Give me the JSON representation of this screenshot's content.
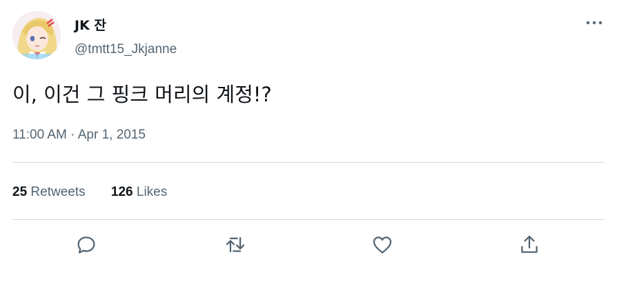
{
  "author": {
    "display_name": "JK 잔",
    "handle": "@tmtt15_Jkjanne",
    "avatar": "anime-girl-avatar"
  },
  "tweet": {
    "text": "이, 이건 그 핑크 머리의 계정!?",
    "time": "11:00 AM",
    "separator": "·",
    "date": "Apr 1, 2015"
  },
  "stats": {
    "retweets_count": "25",
    "retweets_label": "Retweets",
    "likes_count": "126",
    "likes_label": "Likes"
  },
  "actions": {
    "reply": "reply-icon",
    "retweet": "retweet-icon",
    "like": "heart-icon",
    "share": "share-icon"
  },
  "colors": {
    "text_primary": "#0f1419",
    "text_secondary": "#536471",
    "divider": "#cfd9de"
  }
}
